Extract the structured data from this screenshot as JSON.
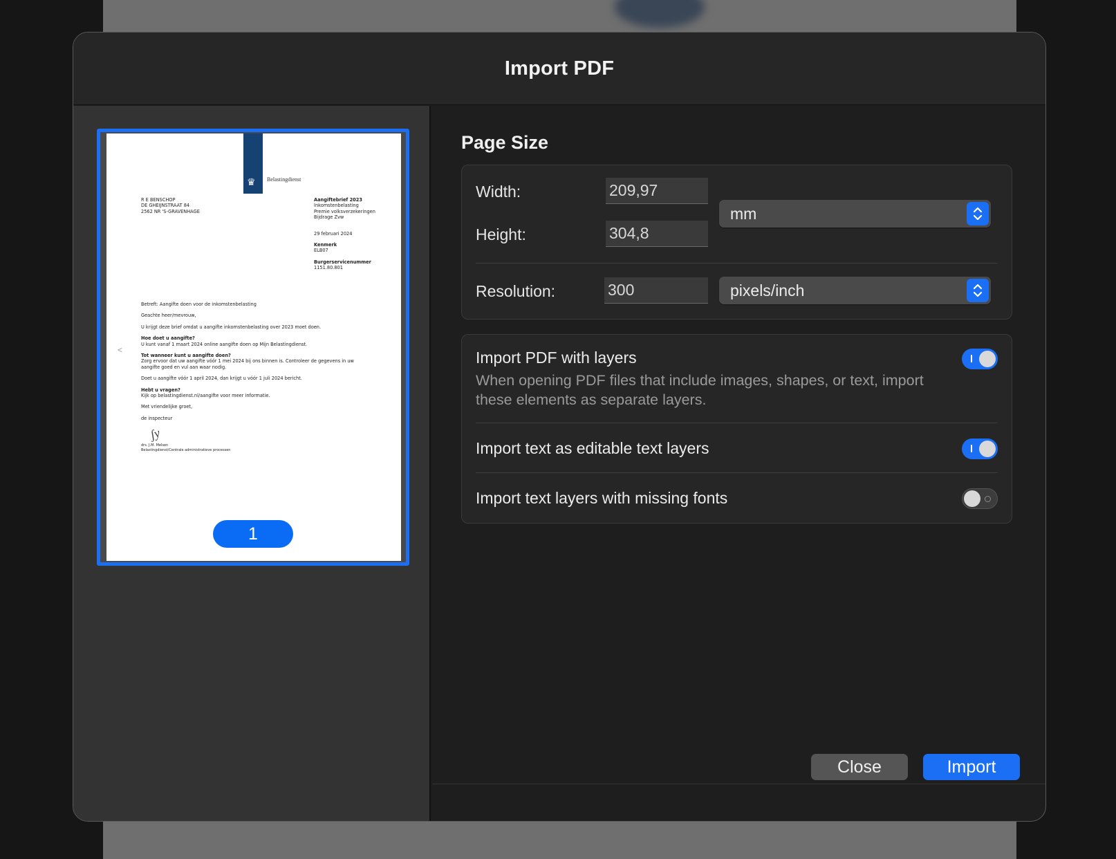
{
  "dialog": {
    "title": "Import PDF"
  },
  "preview": {
    "page_number": "1",
    "document": {
      "logo_text": "Belastingdienst",
      "address": [
        "R E BENSCHOP",
        "DE GHEIJNSTRAAT 84",
        "2562 NR  'S-GRAVENHAGE"
      ],
      "letter_title": "Aangiftebrief 2023",
      "letter_subtitle": [
        "Inkomstenbelasting",
        "Premie volksverzekeringen",
        "Bijdrage Zvw"
      ],
      "date": "29 februari 2024",
      "kenmerk_label": "Kenmerk",
      "kenmerk_value": "ELB07",
      "bsn_label": "Burgerservicenummer",
      "bsn_value": "1151.80.801",
      "subject": "Betreft: Aangifte doen voor de inkomstenbelasting",
      "greeting": "Geachte heer/mevrouw,",
      "intro": "U krijgt deze brief omdat u aangifte inkomstenbelasting over 2023 moet doen.",
      "h1": "Hoe doet u aangifte?",
      "p1": "U kunt vanaf 1 maart 2024 online aangifte doen op Mijn Belastingdienst.",
      "h2": "Tot wanneer kunt u aangifte doen?",
      "p2a": "Zorg ervoor dat uw aangifte vóór 1 mei 2024 bij ons binnen is. Controleer de gegevens in uw",
      "p2b": "aangifte goed en vul aan waar nodig.",
      "p3": "Doet u aangifte vóór 1 april 2024, dan krijgt u vóór 1 juli 2024 bericht.",
      "h3": "Hebt u vragen?",
      "p4": "Kijk op belastingdienst.nl/aangifte voor meer informatie.",
      "closing": "Met vriendelijke groet,",
      "sender": "de inspecteur",
      "sig_name": "drs. J.M. Melsen",
      "sig_dept": "Belastingdienst/Centrale administratieve processen"
    }
  },
  "page_size": {
    "title": "Page Size",
    "width_label": "Width:",
    "width_value": "209,97",
    "height_label": "Height:",
    "height_value": "304,8",
    "unit": "mm",
    "resolution_label": "Resolution:",
    "resolution_value": "300",
    "resolution_unit": "pixels/inch"
  },
  "options": {
    "layers_title": "Import PDF with layers",
    "layers_desc": "When opening PDF files that include images, shapes, or text, import these elements as separate layers.",
    "layers_on": true,
    "text_title": "Import text as editable text layers",
    "text_on": true,
    "fonts_title": "Import text layers with missing fonts",
    "fonts_on": false
  },
  "buttons": {
    "close": "Close",
    "import": "Import"
  },
  "colors": {
    "accent": "#1a6ff5",
    "panel": "#262626",
    "background": "#1e1e1e"
  }
}
